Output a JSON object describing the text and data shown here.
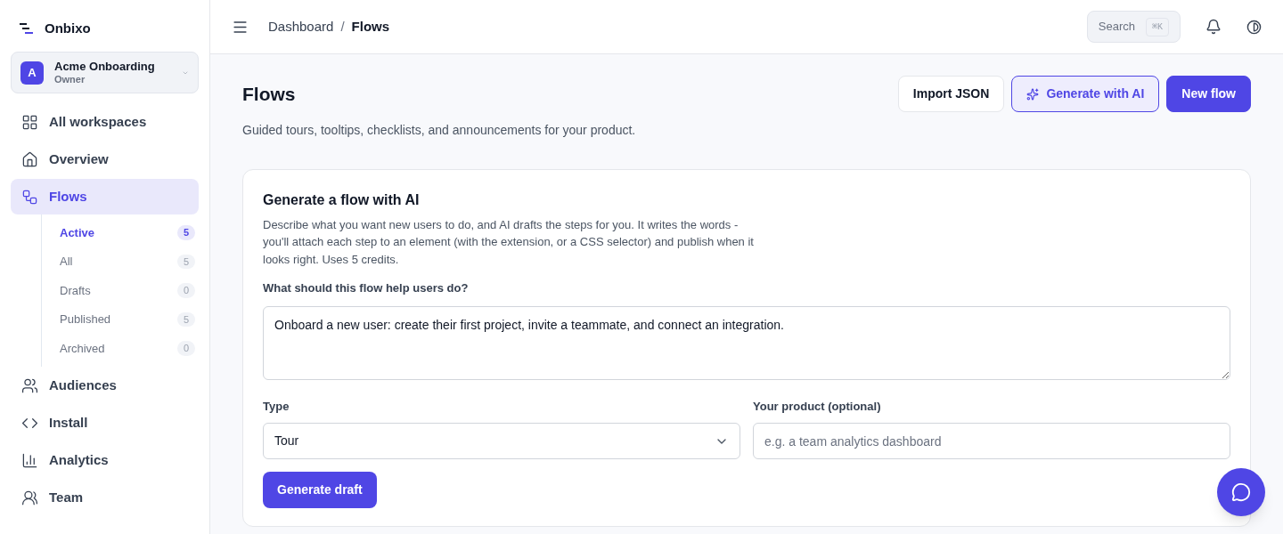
{
  "brand": {
    "name": "Onbixo"
  },
  "workspace": {
    "initial": "A",
    "name": "Acme Onboarding",
    "role": "Owner"
  },
  "nav": [
    {
      "label": "All workspaces",
      "selected": false
    },
    {
      "label": "Overview",
      "selected": false
    },
    {
      "label": "Flows",
      "selected": true,
      "children": [
        {
          "label": "Active",
          "count": "5",
          "selected": true
        },
        {
          "label": "All",
          "count": "5",
          "selected": false
        },
        {
          "label": "Drafts",
          "count": "0",
          "selected": false
        },
        {
          "label": "Published",
          "count": "5",
          "selected": false
        },
        {
          "label": "Archived",
          "count": "0",
          "selected": false
        }
      ]
    },
    {
      "label": "Audiences",
      "selected": false
    },
    {
      "label": "Install",
      "selected": false
    },
    {
      "label": "Analytics",
      "selected": false
    },
    {
      "label": "Team",
      "selected": false
    }
  ],
  "header": {
    "breadcrumb": [
      "Dashboard",
      "Flows"
    ],
    "separator": "/",
    "search": {
      "placeholder": "Search",
      "shortcut": "⌘K"
    }
  },
  "page": {
    "title": "Flows",
    "subtitle": "Guided tours, tooltips, checklists, and announcements for your product.",
    "actions": [
      {
        "label": "Import JSON",
        "kind": "outline"
      },
      {
        "label": "Generate with AI",
        "kind": "ai"
      },
      {
        "label": "New flow",
        "kind": "primary"
      }
    ]
  },
  "generator": {
    "title": "Generate a flow with AI",
    "description": "Describe what you want new users to do, and AI drafts the steps for you. It writes the words - you'll attach each step to an element (with the extension, or a CSS selector) and publish when it looks right. Uses 5 credits.",
    "prompt": {
      "label": "What should this flow help users do?",
      "value": "Onboard a new user: create their first project, invite a teammate, and connect an integration."
    },
    "type": {
      "label": "Type",
      "value": "Tour"
    },
    "product": {
      "label": "Your product (optional)",
      "placeholder": "e.g. a team analytics dashboard"
    },
    "submit": "Generate draft"
  }
}
